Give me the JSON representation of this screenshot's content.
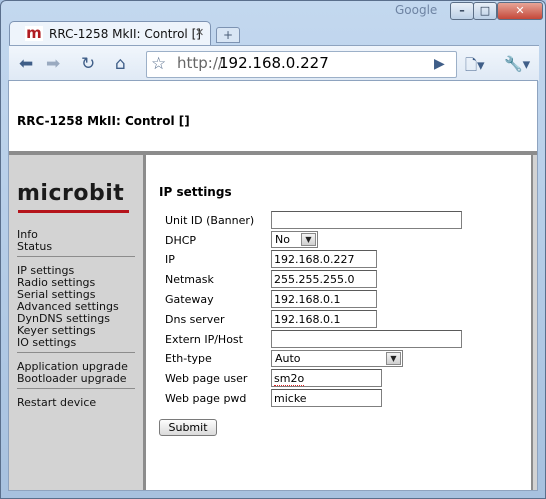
{
  "browser": {
    "brand_label": "Google",
    "tab_title": "RRC-1258 MkII: Control []",
    "tab_favicon": "m",
    "new_tab_label": "+",
    "url_scheme": "http://",
    "url_host": "192.168.0.227",
    "icons": {
      "back": "back-arrow-icon",
      "forward": "forward-arrow-icon",
      "reload": "reload-icon",
      "home": "home-icon",
      "bookmark": "star-icon",
      "go": "go-icon",
      "page_menu": "page-menu-icon",
      "wrench_menu": "wrench-icon"
    }
  },
  "page": {
    "title": "RRC-1258 MkII: Control []",
    "logo_text": "microbit",
    "logo_accent_color": "#b5141b"
  },
  "sidebar": {
    "groups": [
      [
        "Info",
        "Status"
      ],
      [
        "IP settings",
        "Radio settings",
        "Serial settings",
        "Advanced settings",
        "DynDNS settings",
        "Keyer settings",
        "IO settings"
      ],
      [
        "Application upgrade",
        "Bootloader upgrade"
      ],
      [
        "Restart device"
      ]
    ]
  },
  "form": {
    "title": "IP settings",
    "fields": [
      {
        "label": "Unit ID (Banner)",
        "value": ""
      },
      {
        "label": "DHCP",
        "value": "No"
      },
      {
        "label": "IP",
        "value": "192.168.0.227"
      },
      {
        "label": "Netmask",
        "value": "255.255.255.0"
      },
      {
        "label": "Gateway",
        "value": "192.168.0.1"
      },
      {
        "label": "Dns server",
        "value": "192.168.0.1"
      },
      {
        "label": "Extern IP/Host",
        "value": ""
      },
      {
        "label": "Eth-type",
        "value": "Auto"
      },
      {
        "label": "Web page user",
        "value": "sm2o"
      },
      {
        "label": "Web page pwd",
        "value": "micke"
      }
    ],
    "submit_label": "Submit"
  }
}
